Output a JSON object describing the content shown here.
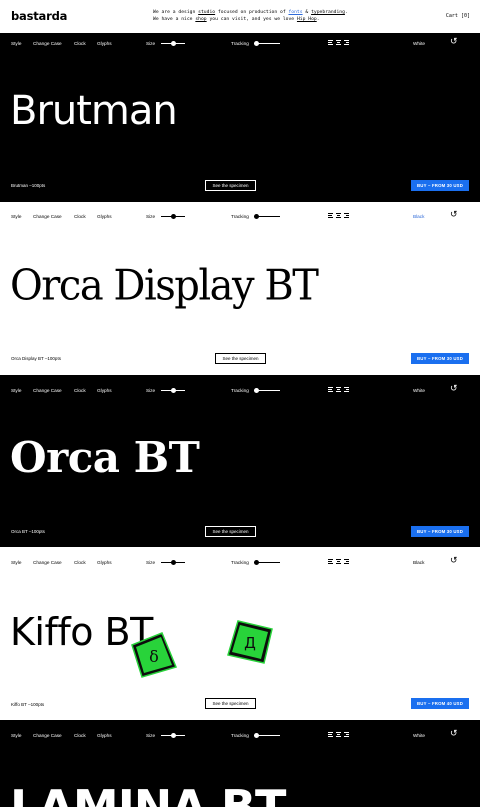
{
  "header": {
    "logo": "bastarda",
    "tagline_1a": "We are a design ",
    "tagline_1b": "studio",
    "tagline_1c": " focused on production of ",
    "tagline_1d": "fonts",
    "tagline_1e": " & ",
    "tagline_1f": "typebranding",
    "tagline_1g": ".",
    "tagline_2a": "We have a nice ",
    "tagline_2b": "shop",
    "tagline_2c": " you can visit, and yes we love ",
    "tagline_2d": "Hip Hop",
    "tagline_2e": ".",
    "cart": "Cart [0]"
  },
  "toolbar": {
    "style": "Style",
    "change_case": "Change Case",
    "clock": "Clock",
    "glyphs": "Glyphs",
    "size": "Size",
    "tracking": "Tracking"
  },
  "sections": [
    {
      "specimen": "Brutman",
      "caption": "Brutman –100pts",
      "theme": "White",
      "specimen_button": "See the specimen",
      "buy": "BUY – FROM 30 USD"
    },
    {
      "specimen": "Orca Display BT",
      "caption": "Orca Display BT –100pts",
      "theme": "Black",
      "specimen_button": "See the specimen",
      "buy": "BUY – FROM 30 USD"
    },
    {
      "specimen": "Orca BT",
      "caption": "Orca BT –100pts",
      "theme": "White",
      "specimen_button": "See the specimen",
      "buy": "BUY – FROM 30 USD"
    },
    {
      "specimen": "Kiffo BT",
      "caption": "Kiffo BT –100pts",
      "theme": "Black",
      "specimen_button": "See the specimen",
      "buy": "BUY – FROM 40 USD",
      "badge_1": "δ",
      "badge_2": "Д"
    },
    {
      "specimen": "LAMINA BT",
      "theme": "White"
    }
  ],
  "colors": {
    "accent": "#1a6fef",
    "link": "#2e6ad8",
    "badge_green": "#28d33a"
  }
}
